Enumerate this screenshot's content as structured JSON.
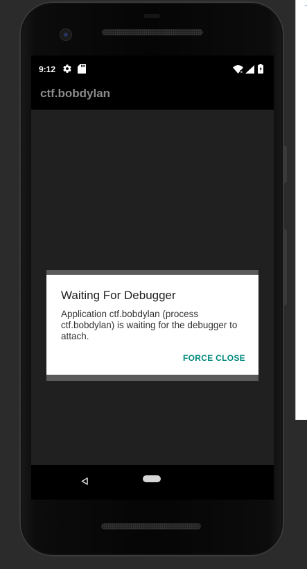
{
  "status_bar": {
    "time": "9:12",
    "icons": [
      "gear-icon",
      "sd-card-icon",
      "wifi-icon",
      "signal-icon",
      "battery-icon"
    ]
  },
  "app_bar": {
    "title": "ctf.bobdylan"
  },
  "dialog": {
    "title": "Waiting For Debugger",
    "message": "Application ctf.bobdylan (process ctf.bobdylan) is waiting for the debugger to attach.",
    "button_label": "FORCE CLOSE"
  },
  "navigation": {
    "icons": [
      "back-icon",
      "home-pill-icon"
    ]
  },
  "colors": {
    "dialog_button": "#00897b",
    "app_title": "#8a8a8a",
    "screen_background": "#202020"
  }
}
